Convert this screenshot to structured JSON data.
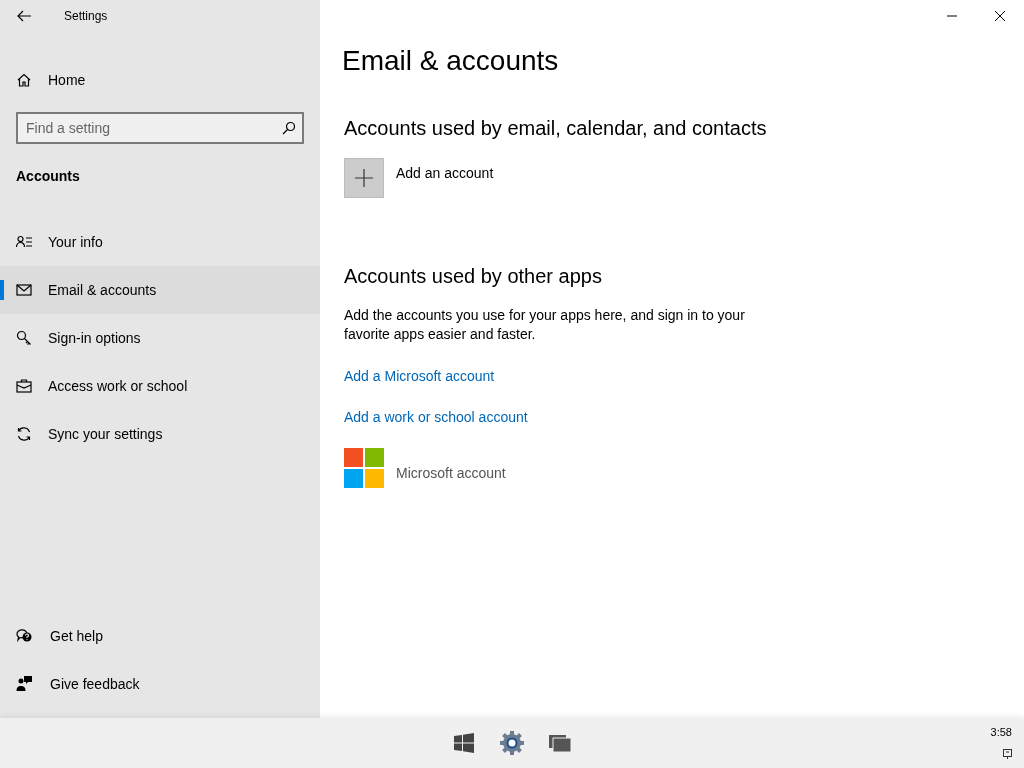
{
  "window": {
    "title": "Settings"
  },
  "sidebar": {
    "home": "Home",
    "search": {
      "placeholder": "Find a setting"
    },
    "section": "Accounts",
    "items": [
      {
        "label": "Your info",
        "kind": "info",
        "selected": false
      },
      {
        "label": "Email & accounts",
        "kind": "mail",
        "selected": true
      },
      {
        "label": "Sign-in options",
        "kind": "key",
        "selected": false
      },
      {
        "label": "Access work or school",
        "kind": "briefcase",
        "selected": false
      },
      {
        "label": "Sync your settings",
        "kind": "sync",
        "selected": false
      }
    ],
    "footer": [
      {
        "label": "Get help",
        "kind": "help"
      },
      {
        "label": "Give feedback",
        "kind": "feedback"
      }
    ]
  },
  "main": {
    "title": "Email & accounts",
    "sections": [
      {
        "heading": "Accounts used by email, calendar, and contacts",
        "add_button": "Add an account"
      },
      {
        "heading": "Accounts used by other apps",
        "description": "Add the accounts you use for your apps here, and sign in to your favorite apps easier and faster.",
        "links": [
          "Add a Microsoft account",
          "Add a work or school account"
        ],
        "accounts": [
          "Microsoft account"
        ]
      }
    ]
  },
  "taskbar": {
    "clock": "3:58"
  }
}
